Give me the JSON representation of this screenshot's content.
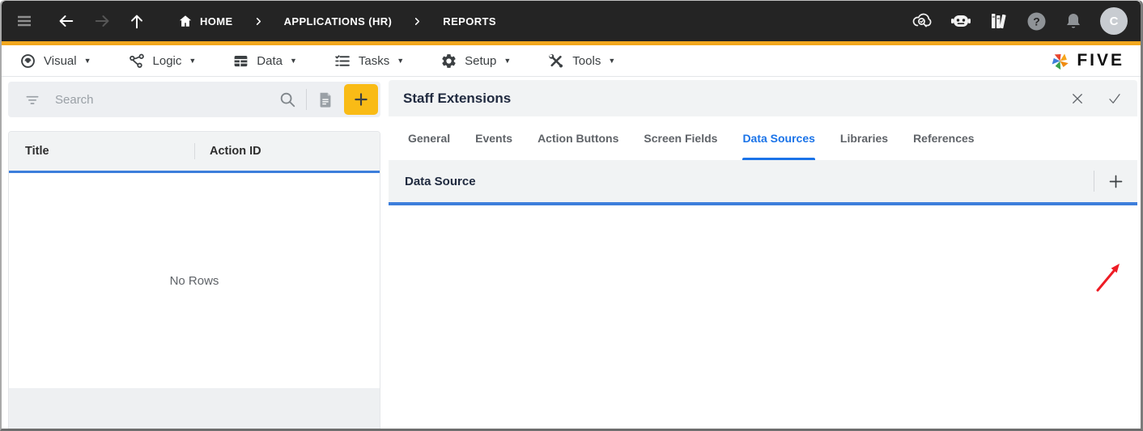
{
  "topbar": {
    "breadcrumb": [
      "HOME",
      "APPLICATIONS (HR)",
      "REPORTS"
    ],
    "avatar_initial": "C"
  },
  "menubar": {
    "items": [
      {
        "label": "Visual"
      },
      {
        "label": "Logic"
      },
      {
        "label": "Data"
      },
      {
        "label": "Tasks"
      },
      {
        "label": "Setup"
      },
      {
        "label": "Tools"
      }
    ],
    "caret": "▼",
    "logo_text": "FIVE"
  },
  "left_panel": {
    "search": {
      "placeholder": "Search"
    },
    "table": {
      "columns": [
        "Title",
        "Action ID"
      ],
      "empty_text": "No Rows"
    }
  },
  "right_panel": {
    "title": "Staff Extensions",
    "tabs": [
      {
        "label": "General"
      },
      {
        "label": "Events"
      },
      {
        "label": "Action Buttons"
      },
      {
        "label": "Screen Fields"
      },
      {
        "label": "Data Sources"
      },
      {
        "label": "Libraries"
      },
      {
        "label": "References"
      }
    ],
    "active_tab": "Data Sources",
    "section": {
      "title": "Data Source"
    }
  },
  "colors": {
    "topbar_bg": "#242424",
    "accent_yellow": "#f2a71d",
    "button_yellow": "#f9bb16",
    "active_tab_blue": "#1a73e8",
    "rule_blue": "#3d7edb"
  }
}
